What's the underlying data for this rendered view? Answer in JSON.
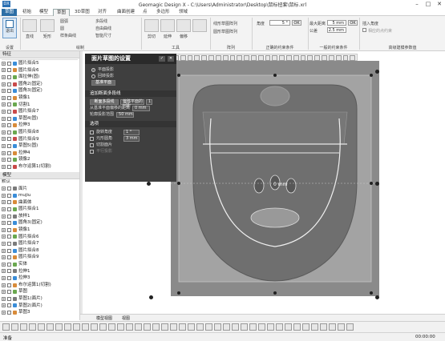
{
  "app": {
    "title": "Geomagic Design X - C:\\Users\\Administrator\\Desktop\\鼠标扭套\\鼠标.xrl",
    "logo": "DX",
    "window_controls": [
      "–",
      "□",
      "✕"
    ]
  },
  "menubar": {
    "items": [
      "草图",
      "初始",
      "模型",
      "草图",
      "3D草图",
      "对齐",
      "曲面创建",
      "点",
      "多边形",
      "领域"
    ]
  },
  "ribbon": {
    "exit_label": "退出",
    "group_setup": "设置",
    "group_draw": "绘制",
    "group_tools": "工具",
    "group_array": "阵列",
    "group_constraint": "正确的约束条件",
    "group_fit": "一般的约束条件",
    "group_highlevel": "高级建模参数值",
    "draw_items": [
      "直线",
      "矩形",
      "圆弧",
      "圆",
      "样条曲线",
      "多段线",
      "自由曲线",
      "智能尺寸"
    ],
    "tool_items": [
      "剪切",
      "延伸",
      "偏移",
      "切换到构造线"
    ],
    "array_items": [
      "线形草图阵列",
      "圆形草图阵列"
    ],
    "angle_label": "角度",
    "angle_value": "5 °",
    "ok_label": "OK",
    "distance_label": "最大距离",
    "distance_value": "5 mm",
    "tolerance_label": "公差",
    "tolerance_value": "2.5 mm",
    "insert_label": "插入角度",
    "checkbox_label": "相应的点约束"
  },
  "left_panel": {
    "features_title": "特征",
    "features": [
      "圆片拟合5",
      "圆片拟合6",
      "面拉伸(固)",
      "圆角2(固定)",
      "圆角3(固定)",
      "镜像1",
      "切割1",
      "圆片拟合7",
      "草图4(固)",
      "拉伸3",
      "圆片拟合8",
      "圆片拟合9",
      "草图5(固)",
      "拉伸4",
      "镜像2",
      "布尔运算1(切割)"
    ],
    "model_title": "模型",
    "default_label": "默认",
    "model_items": [
      "面片",
      "mujiu",
      "曲面体",
      "圆片拟合1",
      "放样1",
      "圆角3(固定)",
      "镜像1",
      "圆片拟合6",
      "圆片拟合7",
      "圆片拟合8",
      "圆片拟合9",
      "实体",
      "拉伸1",
      "拉伸3",
      "布尔运算1(切割)",
      "草图",
      "草图1(面片)",
      "草图2(面片)",
      "草图3"
    ]
  },
  "dialog": {
    "title": "面片草图的设置",
    "radio_plane": "平面投影",
    "radio_rotate": "回转投影",
    "base_plane_label": "基准平面",
    "section_contour": "追加断面多段线",
    "section_button": "断面多段线",
    "count_label": "偏移平面的间距",
    "count_value": "1",
    "offset_label": "从基准平面偏移的距离",
    "offset_value": "0 mm",
    "contour_range_label": "轮廓投影范围",
    "contour_range_value": "50 mm",
    "options_title": "选项",
    "opt_rotate": "旋转角度",
    "opt_rotate_value": "1 °",
    "opt_smooth": "元形圆角",
    "opt_smooth_value": "3 mm",
    "opt_mesh": "切割面片",
    "opt_parallel": "平行投影"
  },
  "viewport": {
    "dimension_label": "0 mm",
    "mesh_color": "#6f6f6f",
    "overlay_color": "#a9a9a9"
  },
  "bottom_tabs": [
    "模型视图",
    "视图"
  ],
  "statusbar": {
    "ready": "准备",
    "time": "00:00:00"
  },
  "colors": {
    "accent": "#2d6ea5",
    "dialog_bg": "#3f3f3f",
    "mesh_bg": "#8a8a8a"
  }
}
